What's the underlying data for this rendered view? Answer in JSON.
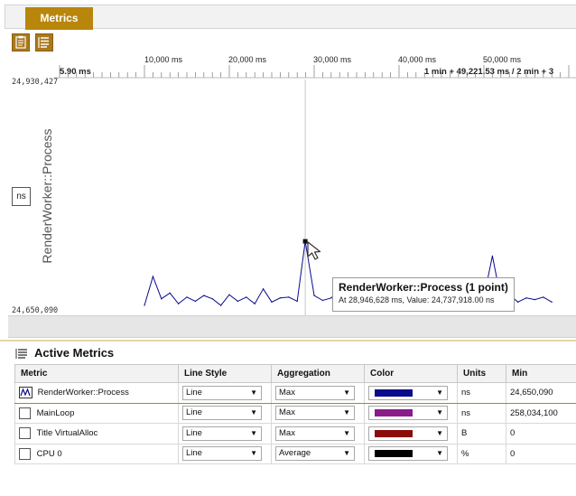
{
  "tab": {
    "label": "Metrics"
  },
  "ruler": {
    "ticks": [
      "10,000 ms",
      "20,000 ms",
      "30,000 ms",
      "40,000 ms",
      "50,000 ms"
    ],
    "start_label": "5.90 ms",
    "end_label": "1 min + 49,221.53 ms / 2 min + 3"
  },
  "chart": {
    "ymax_label": "24,930,427",
    "ymin_label": "24,650,090",
    "ytitle": "RenderWorker::Process",
    "units": "ns"
  },
  "tooltip": {
    "title": "RenderWorker::Process (1 point)",
    "detail": "At 28,946,628 ms, Value: 24,737,918.00 ns"
  },
  "chart_data": {
    "type": "line",
    "title": "",
    "ylabel": "RenderWorker::Process",
    "ylim": [
      24650090,
      24930427
    ],
    "series": [
      {
        "name": "RenderWorker::Process",
        "x": [
          10000,
          11000,
          12000,
          13000,
          14000,
          15000,
          16000,
          17000,
          18000,
          19000,
          20000,
          21000,
          22000,
          23000,
          24000,
          25000,
          26000,
          27000,
          28000,
          28946.628,
          30000,
          31000,
          32000,
          33000,
          34000,
          35000,
          36000,
          37000,
          38000,
          39000,
          40000,
          41000,
          42000,
          43000,
          44000,
          45000,
          46000,
          47000,
          48000,
          49000,
          50000,
          51000,
          52000,
          53000,
          54000,
          55000,
          56000,
          57000,
          58000
        ],
        "values": [
          24660000,
          24695000,
          24668000,
          24675000,
          24662000,
          24670000,
          24665000,
          24672000,
          24668000,
          24660000,
          24673000,
          24665000,
          24670000,
          24662000,
          24680000,
          24664000,
          24669000,
          24670000,
          24665000,
          24737918,
          24672000,
          24666000,
          24669000,
          24678000,
          24662000,
          24672000,
          24666000,
          24670000,
          24664000,
          24668000,
          24671000,
          24665000,
          24669000,
          24680000,
          24666000,
          24672000,
          24664000,
          24669000,
          24671000,
          24665000,
          24670000,
          24720000,
          24668000,
          24673000,
          24664000,
          24669000,
          24667000,
          24670000,
          24664000
        ]
      }
    ]
  },
  "section": {
    "title": "Active Metrics"
  },
  "table": {
    "headers": [
      "Metric",
      "Line Style",
      "Aggregation",
      "Color",
      "Units",
      "Min"
    ],
    "rows": [
      {
        "checked": true,
        "name": "RenderWorker::Process",
        "style": "Line",
        "agg": "Max",
        "color": "#0a0a8c",
        "units": "ns",
        "min": "24,650,090"
      },
      {
        "checked": false,
        "name": "MainLoop",
        "style": "Line",
        "agg": "Max",
        "color": "#8b1a8b",
        "units": "ns",
        "min": "258,034,100"
      },
      {
        "checked": false,
        "name": "Title VirtualAlloc",
        "style": "Line",
        "agg": "Max",
        "color": "#8b0a0a",
        "units": "B",
        "min": "0"
      },
      {
        "checked": false,
        "name": "CPU 0",
        "style": "Line",
        "agg": "Average",
        "color": "#000000",
        "units": "%",
        "min": "0"
      }
    ]
  },
  "colors": {
    "accent": "#b8860b",
    "series_line": "#0a0a8c"
  },
  "icons": [
    "clipboard-icon",
    "list-icon",
    "metric-chart-icon",
    "cursor-arrow-icon"
  ]
}
